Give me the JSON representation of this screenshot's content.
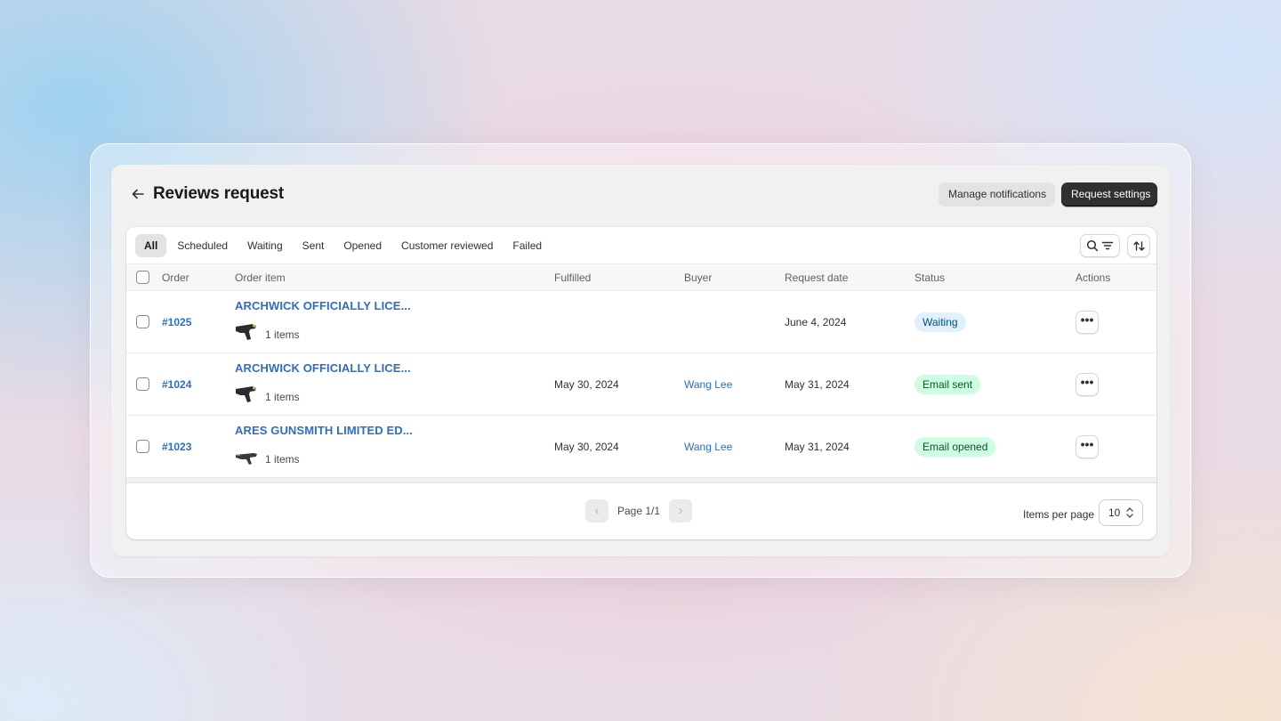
{
  "header": {
    "title": "Reviews request",
    "manage_notifications": "Manage notifications",
    "request_settings": "Request settings"
  },
  "tabs": [
    "All",
    "Scheduled",
    "Waiting",
    "Sent",
    "Opened",
    "Customer reviewed",
    "Failed"
  ],
  "active_tab": "All",
  "columns": {
    "order": "Order",
    "order_item": "Order item",
    "fulfilled": "Fulfilled",
    "buyer": "Buyer",
    "request_date": "Request date",
    "status": "Status",
    "actions": "Actions"
  },
  "rows": [
    {
      "order": "#1025",
      "product": "ARCHWICK OFFICIALLY LICE...",
      "items": "1 items",
      "fulfilled": "",
      "buyer": "",
      "request_date": "June 4, 2024",
      "status": "Waiting",
      "status_color": "#e0f0ff",
      "status_text_color": "#00527c",
      "actions": "•••"
    },
    {
      "order": "#1024",
      "product": "ARCHWICK OFFICIALLY LICE...",
      "items": "1 items",
      "fulfilled": "May 30, 2024",
      "buyer": "Wang Lee",
      "request_date": "May 31, 2024",
      "status": "Email sent",
      "status_color": "#cdfee1",
      "status_text_color": "#0c5132",
      "actions": "•••"
    },
    {
      "order": "#1023",
      "product": "ARES GUNSMITH LIMITED ED...",
      "items": "1 items",
      "fulfilled": "May 30, 2024",
      "buyer": "Wang Lee",
      "request_date": "May 31, 2024",
      "status": "Email opened",
      "status_color": "#cdfee1",
      "status_text_color": "#0c5132",
      "actions": "•••"
    }
  ],
  "pagination": {
    "prev": "‹",
    "next": "›",
    "label": "Page 1/1",
    "items_per_page_label": "Items per page",
    "items_per_page": "10"
  }
}
